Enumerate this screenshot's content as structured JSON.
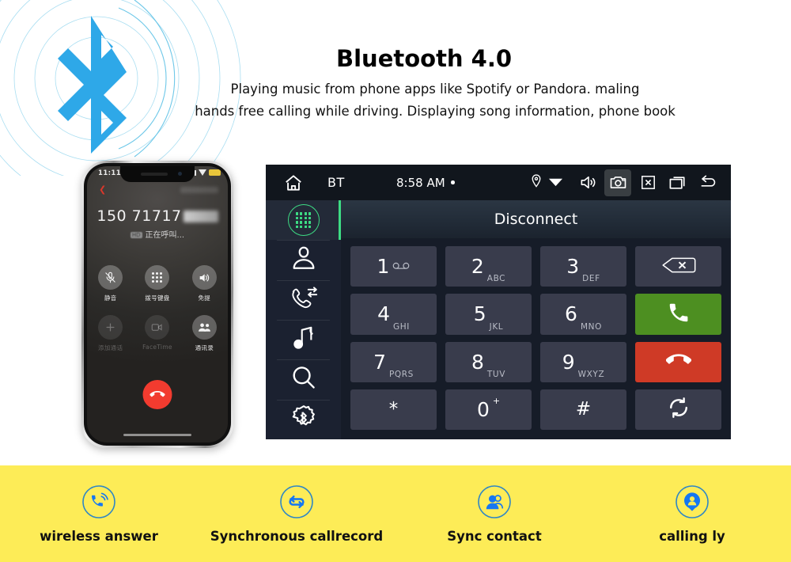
{
  "hero": {
    "title": "Bluetooth 4.0",
    "desc_line1": "Playing music from phone apps like Spotify or Pandora. maling",
    "desc_line2": "hands free calling while driving. Displaying  song information, phone book",
    "logo_color": "#2ea8e8",
    "wave_color": "#7fd0ee"
  },
  "phone": {
    "status_time": "11:11",
    "number": "150 71717",
    "calling_text": "正在呼叫...",
    "calling_tag": "HD",
    "keys": [
      {
        "label": "静音",
        "icon": "mute-icon",
        "dim": false
      },
      {
        "label": "拨号键盘",
        "icon": "keypad-icon",
        "dim": false
      },
      {
        "label": "免提",
        "icon": "speaker-icon",
        "dim": false
      },
      {
        "label": "添加通话",
        "icon": "add-call-icon",
        "dim": true
      },
      {
        "label": "FaceTime",
        "icon": "facetime-icon",
        "dim": true
      },
      {
        "label": "通讯录",
        "icon": "contacts-icon",
        "dim": false
      }
    ],
    "end_call_icon": "end-call-icon",
    "end_call_color": "#f23b2f"
  },
  "head_unit": {
    "topbar": {
      "home_icon": "home-icon",
      "source_label": "BT",
      "time": "8:58 AM",
      "icons": [
        "location-pin-icon",
        "wifi-icon",
        "volume-icon",
        "camera-icon",
        "close-box-icon",
        "recents-icon",
        "back-arrow-icon"
      ],
      "highlighted_icon": "camera-icon"
    },
    "sidebar": [
      {
        "name": "dialpad",
        "icon": "dialpad-icon",
        "active": true
      },
      {
        "name": "contacts",
        "icon": "contact-person-icon",
        "active": false
      },
      {
        "name": "call-log",
        "icon": "call-log-icon",
        "active": false
      },
      {
        "name": "music",
        "icon": "music-note-icon",
        "active": false
      },
      {
        "name": "search",
        "icon": "search-icon",
        "active": false
      },
      {
        "name": "bluetooth-settings",
        "icon": "bluetooth-gear-icon",
        "active": false
      }
    ],
    "header_title": "Disconnect",
    "accent_color": "#3ddc84",
    "key_color": "#393c4c",
    "call_color": "#4d8f21",
    "hangup_color": "#cf3a26",
    "dialpad": [
      {
        "num": "1",
        "sub": "",
        "icon": "voicemail-icon",
        "type": "normal"
      },
      {
        "num": "2",
        "sub": "ABC",
        "icon": "",
        "type": "normal"
      },
      {
        "num": "3",
        "sub": "DEF",
        "icon": "",
        "type": "normal"
      },
      {
        "num": "",
        "sub": "",
        "icon": "backspace-icon",
        "type": "normal"
      },
      {
        "num": "4",
        "sub": "GHI",
        "icon": "",
        "type": "normal"
      },
      {
        "num": "5",
        "sub": "JKL",
        "icon": "",
        "type": "normal"
      },
      {
        "num": "6",
        "sub": "MNO",
        "icon": "",
        "type": "normal"
      },
      {
        "num": "",
        "sub": "",
        "icon": "call-icon",
        "type": "green"
      },
      {
        "num": "7",
        "sub": "PQRS",
        "icon": "",
        "type": "normal"
      },
      {
        "num": "8",
        "sub": "TUV",
        "icon": "",
        "type": "normal"
      },
      {
        "num": "9",
        "sub": "WXYZ",
        "icon": "",
        "type": "normal"
      },
      {
        "num": "",
        "sub": "",
        "icon": "hangup-icon",
        "type": "red"
      },
      {
        "num": "*",
        "sub": "",
        "icon": "",
        "type": "sym"
      },
      {
        "num": "0",
        "sub": "+",
        "icon": "",
        "type": "sym-plus"
      },
      {
        "num": "#",
        "sub": "",
        "icon": "",
        "type": "sym"
      },
      {
        "num": "",
        "sub": "",
        "icon": "sync-icon",
        "type": "normal"
      }
    ]
  },
  "features": {
    "background": "#fdec57",
    "icon_color": "#1577f2",
    "items": [
      {
        "label": "wireless answer",
        "icon": "wireless-call-icon"
      },
      {
        "label": "Synchronous callrecord",
        "icon": "sync-arrows-icon"
      },
      {
        "label": "Sync contact",
        "icon": "two-people-icon"
      },
      {
        "label": "calling ly",
        "icon": "person-pin-icon"
      }
    ]
  }
}
